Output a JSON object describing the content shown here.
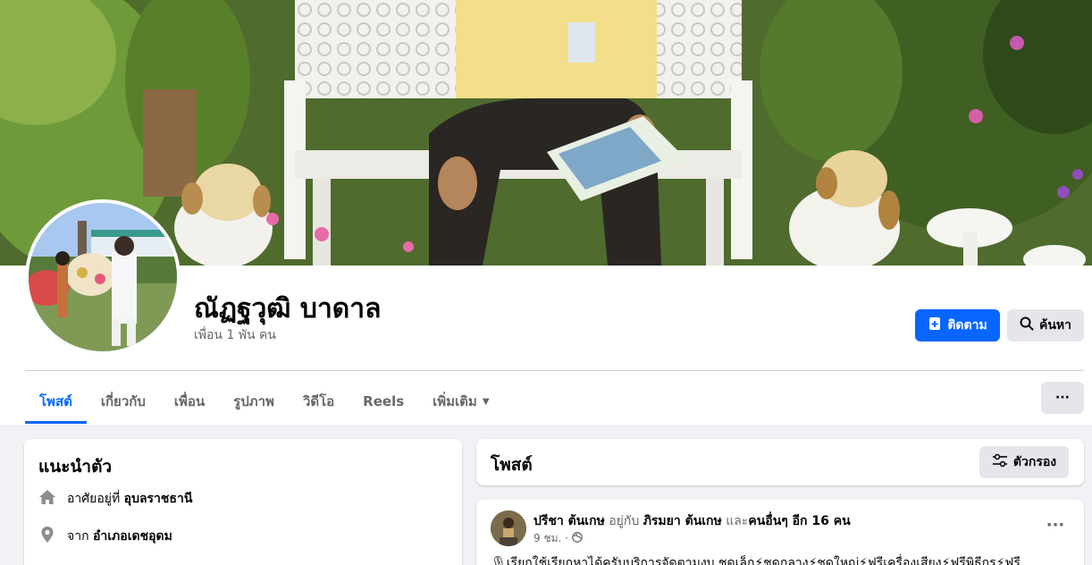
{
  "profile": {
    "name": "ณัฏฐวุฒิ บาดาล",
    "friends": "เพื่อน 1 พัน คน"
  },
  "actions": {
    "follow_label": "ติดตาม",
    "search_label": "ค้นหา",
    "more_label": "···"
  },
  "tabs": [
    {
      "label": "โพสต์",
      "active": true
    },
    {
      "label": "เกี่ยวกับ"
    },
    {
      "label": "เพื่อน"
    },
    {
      "label": "รูปภาพ"
    },
    {
      "label": "วิดีโอ"
    },
    {
      "label": "Reels"
    },
    {
      "label": "เพิ่มเติม"
    }
  ],
  "intro": {
    "title": "แนะนำตัว",
    "lives_prefix": "อาศัยอยู่ที่",
    "lives_place": "อุบลราชธานี",
    "from_prefix": "จาก",
    "from_place": "อำเภอเดชอุดม"
  },
  "posts": {
    "title": "โพสต์",
    "filter_label": "ตัวกรอง"
  },
  "post": {
    "author": "ปรีชา ต้นเกษ",
    "with_text": "อยู่กับ",
    "tagged": "ภิรมยา ต้นเกษ",
    "and_text": "และ",
    "others": "คนอื่นๆ อีก 16 คน",
    "time": "9 ชม. ·",
    "body": "🎙เรียกใช้เรียกหาได้ครับบริการจัดตามงบ ชุดเล็ก⚡ชุดกลาง⚡ชุดใหญ่⚡ฟรีเครื่องเสียง⚡ฟรีพิธีกร⚡ฟรี"
  },
  "colors": {
    "accent": "#0866ff",
    "muted": "#65676b",
    "button_gray": "#e4e6eb"
  }
}
